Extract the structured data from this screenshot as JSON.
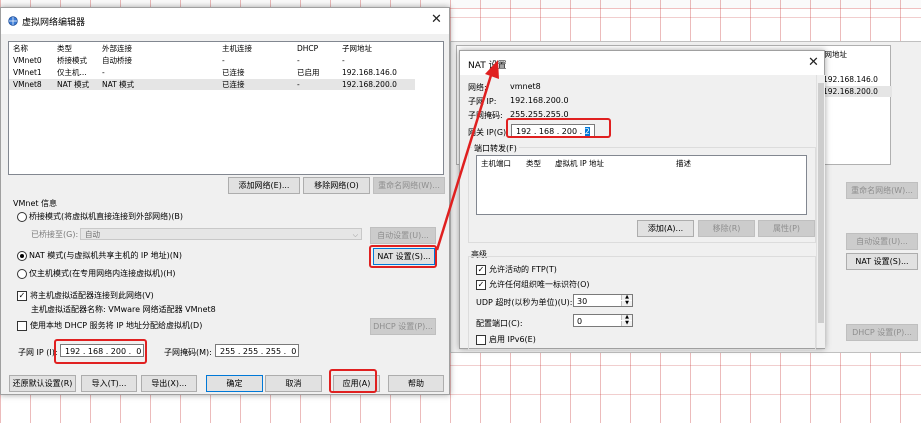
{
  "main_dialog": {
    "title": "虚拟网络编辑器",
    "columns": [
      "名称",
      "类型",
      "外部连接",
      "主机连接",
      "DHCP",
      "子网地址"
    ],
    "rows": [
      [
        "VMnet0",
        "桥接模式",
        "自动桥接",
        "-",
        "-",
        "-"
      ],
      [
        "VMnet1",
        "仅主机...",
        "-",
        "已连接",
        "已启用",
        "192.168.146.0"
      ],
      [
        "VMnet8",
        "NAT 模式",
        "NAT 模式",
        "已连接",
        "-",
        "192.168.200.0"
      ]
    ],
    "add_network": "添加网络(E)...",
    "remove_network": "移除网络(O)",
    "rename_network": "重命名网络(W)...",
    "vmnet_info": "VMnet 信息",
    "bridge_mode": "桥接模式(将虚拟机直接连接到外部网络)(B)",
    "bridged_to_label": "已桥接至(G):",
    "bridged_to_value": "自动",
    "auto_settings": "自动设置(U)...",
    "nat_mode": "NAT 模式(与虚拟机共享主机的 IP 地址)(N)",
    "nat_settings": "NAT 设置(S)...",
    "host_only": "仅主机模式(在专用网络内连接虚拟机)(H)",
    "connect_adapter": "将主机虚拟适配器连接到此网络(V)",
    "adapter_name": "主机虚拟适配器名称: VMware 网络适配器 VMnet8",
    "use_dhcp": "使用本地 DHCP 服务将 IP 地址分配给虚拟机(D)",
    "dhcp_settings": "DHCP 设置(P)...",
    "subnet_ip_label": "子网 IP (I):",
    "subnet_ip": "192 . 168 . 200 .  0",
    "subnet_mask_label": "子网掩码(M):",
    "subnet_mask": "255 . 255 . 255 .  0",
    "restore_defaults": "还原默认设置(R)",
    "import": "导入(T)...",
    "export": "导出(X)...",
    "ok": "确定",
    "cancel": "取消",
    "apply": "应用(A)",
    "help": "帮助"
  },
  "nat_dialog": {
    "title": "NAT 设置",
    "network_label": "网络:",
    "network_value": "vmnet8",
    "subnet_ip_label": "子网 IP:",
    "subnet_ip_value": "192.168.200.0",
    "subnet_mask_label": "子网掩码:",
    "subnet_mask_value": "255.255.255.0",
    "gateway_label": "网关 IP(G):",
    "gateway_prefix": "192 . 168 . 200 . ",
    "gateway_last": "2",
    "port_forward": "端口转发(F)",
    "pf_columns": [
      "主机端口",
      "类型",
      "虚拟机 IP 地址",
      "描述"
    ],
    "add": "添加(A)...",
    "remove": "移除(R)",
    "properties": "属性(P)",
    "advanced": "高级",
    "allow_ftp": "允许活动的 FTP(T)",
    "allow_uid": "允许任何组织唯一标识符(O)",
    "udp_label": "UDP 超时(以秒为单位)(U):",
    "udp_value": "30",
    "config_port_label": "配置端口(C):",
    "config_port_value": "0",
    "ipv6": "启用 IPv6(E)"
  },
  "behind_dialog": {
    "header_col": "子网地址",
    "ip1": "192.168.146.0",
    "ip2": "192.168.200.0",
    "rename": "重命名网络(W)...",
    "auto": "自动设置(U)...",
    "nat": "NAT 设置(S)...",
    "dhcp": "DHCP 设置(P)..."
  },
  "colors": {
    "highlight_red": "#e02020",
    "selection_blue": "#0078d7"
  }
}
